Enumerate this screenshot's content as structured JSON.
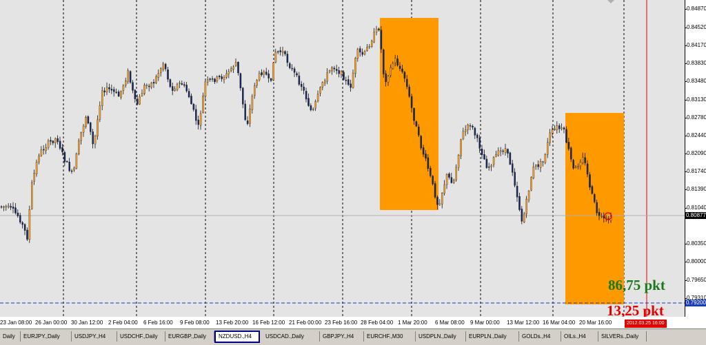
{
  "price_axis": {
    "labels": [
      "0.84870",
      "0.84520",
      "0.84170",
      "0.83830",
      "0.83480",
      "0.83130",
      "0.82780",
      "0.82440",
      "0.82090",
      "0.81740",
      "0.81390",
      "0.81040",
      "0.80350",
      "0.80000",
      "0.79650",
      "0.79310"
    ],
    "current_price": "0.80877",
    "line_price": "0.79200"
  },
  "time_axis": {
    "labels": [
      "23 Jan 08:00",
      "26 Jan 00:00",
      "30 Jan 12:00",
      "2 Feb 04:00",
      "6 Feb 16:00",
      "9 Feb 08:00",
      "13 Feb 20:00",
      "16 Feb 12:00",
      "21 Feb 00:00",
      "23 Feb 16:00",
      "28 Feb 04:00",
      "1 Mar 20:00",
      "6 Mar 08:00",
      "9 Mar 00:00",
      "13 Mar 12:00",
      "16 Mar 04:00",
      "20 Mar 16:00"
    ],
    "marker": "2012.03.25 16:00"
  },
  "annotations": {
    "pkt_green": "86,75 pkt",
    "pkt_red": "13,25 pkt"
  },
  "tabs": [
    {
      "label": "Daily"
    },
    {
      "label": "EURJPY.,Daily"
    },
    {
      "label": "USDJPY.,H4"
    },
    {
      "label": "USDCHF.,Daily"
    },
    {
      "label": "EURGBP.,Daily"
    },
    {
      "label": "NZDUSD.,H4",
      "active": true
    },
    {
      "label": "USDCAD.,Daily"
    },
    {
      "label": "GBPJPY.,H4"
    },
    {
      "label": "EURCHF.,M30"
    },
    {
      "label": "USDPLN.,Daily"
    },
    {
      "label": "EURPLN.,Daily"
    },
    {
      "label": "GOLDs.,H4"
    },
    {
      "label": "OILs.,H4"
    },
    {
      "label": "SILVERs.,Daily"
    }
  ],
  "colors": {
    "chart_bg": "#e4e4e4",
    "bull_candle": "#f0a030",
    "bear_candle": "#1a2a60",
    "highlight": "#ff9900",
    "pkt_green": "#1a7a1a",
    "pkt_red": "#e00000",
    "dashed_line": "#1a3cc0"
  }
}
